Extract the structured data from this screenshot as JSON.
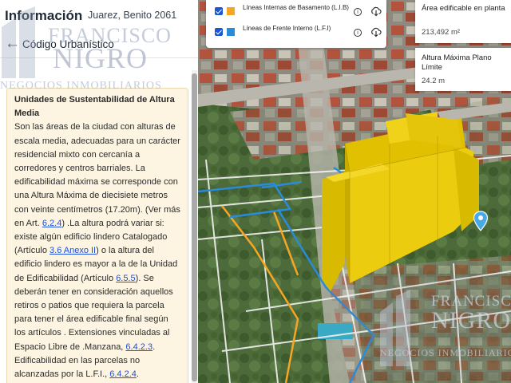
{
  "header": {
    "title": "Información",
    "address": "Juarez, Benito 2061"
  },
  "nav": {
    "back_label": "Código Urbanístico"
  },
  "card": {
    "heading": "Unidades de Sustentabilidad de Altura Media",
    "p1": "Son las áreas de la ciudad con alturas de escala media, adecuadas para un carácter residencial mixto con cercanía a corredores y centros barriales. La edificabilidad máxima se corresponde con una Altura Máxima de diecisiete metros con veinte centímetros (17.20m). (Ver más en Art. ",
    "link1": "6.2.4",
    "p2": ") .La altura podrá variar si: existe algún edificio lindero Catalogado (Artículo ",
    "link2": "3.6 Anexo II",
    "p3": ") o la altura del edificio lindero es mayor a la de la Unidad de Edificabilidad (Artículo ",
    "link3": "6.5.5",
    "p4": "). Se deberán tener en consideración aquellos retiros o patios que requiera la parcela para tener el área edificable final según los artículos . Extensiones vinculadas al Espacio Libre de .Manzana, ",
    "link4": "6.4.2.3",
    "p5": ". Edificabilidad en las parcelas no alcanzadas por la L.F.I., ",
    "link5": "6.4.2.4",
    "p6": "."
  },
  "legend": {
    "items": [
      {
        "label": "Líneas Internas de Basamento (L.I.B)",
        "color": "#f5a623",
        "checked": true
      },
      {
        "label": "Líneas de Frente Interno (L.F.I)",
        "color": "#2a8bd8",
        "checked": true
      }
    ],
    "info_icon": "info-icon",
    "download_icon": "cloud-download-icon"
  },
  "stats": {
    "area_label": "Área edificable en planta",
    "area_value": "213,492 m²",
    "height_label": "Altura Máxima Plano Límite",
    "height_value": "24.2 m"
  },
  "watermark": {
    "line1": "FRANCISCO",
    "line2": "NIGRO",
    "line3": "NEGOCIOS INMOBILIARIOS"
  },
  "colors": {
    "building": "#e8c900",
    "lib_line": "#f5a623",
    "lfi_line": "#2a8bd8",
    "link": "#1d4fd8",
    "card_bg": "#fdf5e2"
  }
}
